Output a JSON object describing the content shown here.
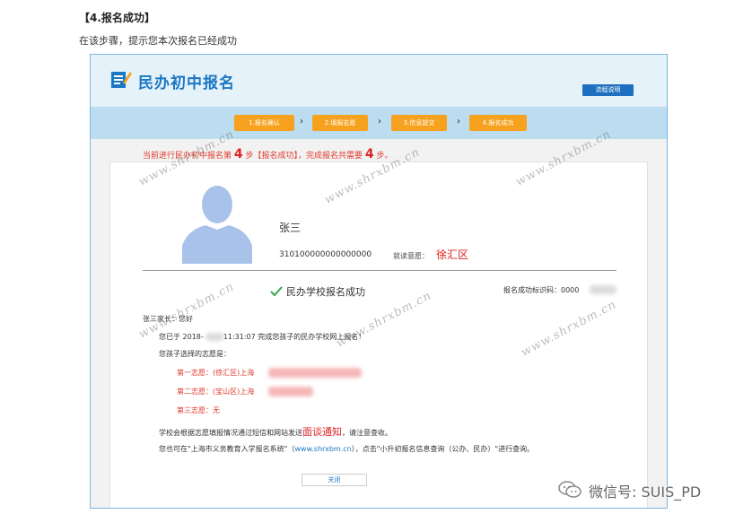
{
  "article": {
    "heading": "【4.报名成功】",
    "description": "在该步骤，提示您本次报名已经成功"
  },
  "app": {
    "title": "民办初中报名",
    "guide_button": "流程说明",
    "accent_color": "#1a77c4"
  },
  "steps": [
    {
      "label": "1.报名确认"
    },
    {
      "label": "2.填报志愿"
    },
    {
      "label": "3.信息提交"
    },
    {
      "label": "4.报名成功"
    }
  ],
  "notice": {
    "prefix": "当前进行民办初中报名第",
    "current_step": "4",
    "middle": "步【报名成功】，完成报名共需要",
    "total_steps": "4",
    "suffix": "步。"
  },
  "student": {
    "name": "张三",
    "id_number": "310100000000000000",
    "school_label": "就读意愿：",
    "school_value": "徐汇区"
  },
  "result": {
    "success_text": "民办学校报名成功",
    "code_label": "报名成功标识码：0000"
  },
  "message": {
    "greeting": "张三家长：您好",
    "line1_prefix": "您已于 2018-",
    "line1_suffix": "11:31:07 完成您孩子的民办学校网上报名！",
    "line2": "您孩子选择的志愿是：",
    "choice1": "第一志愿：(徐汇区)上海",
    "choice2": "第二志愿：(宝山区)上海",
    "choice3": "第三志愿：无",
    "line3_prefix": "学校会根据志愿填报情况通过短信和网站发送",
    "interview": "面谈通知",
    "line3_suffix": "，请注意查收。",
    "line4_prefix": "您也可在\"上海市义务教育入学报名系统\"（",
    "link": "www.shrxbm.cn",
    "line4_suffix": "），点击\"小升初报名信息查询（公办、民办）\"进行查询。"
  },
  "close_button": "关闭",
  "watermark_text": "www.shrxbm.cn",
  "wechat": {
    "text": "微信号: SUIS_PD"
  },
  "icons": [
    "pen-notepad-icon",
    "user-silhouette-icon",
    "checkmark-icon",
    "wechat-icon"
  ]
}
